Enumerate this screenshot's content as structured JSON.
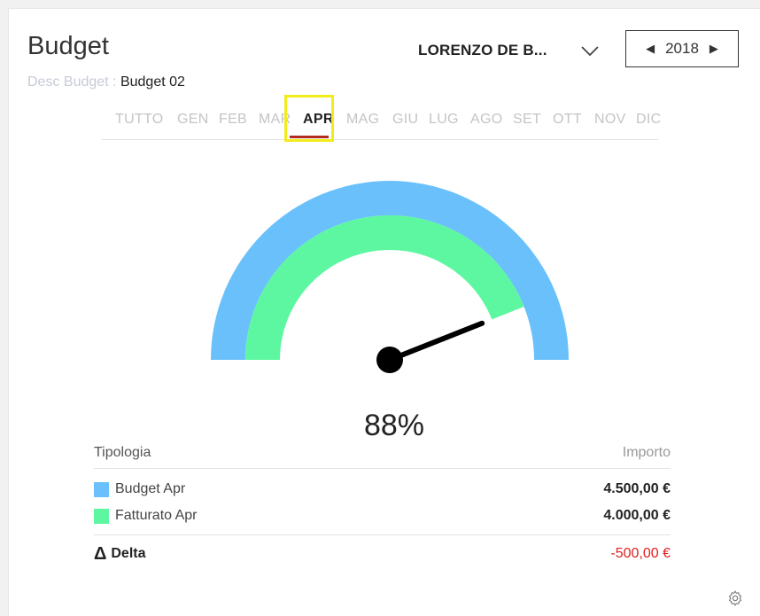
{
  "header": {
    "title": "Budget",
    "desc_label": "Desc Budget :",
    "desc_value": "Budget 02",
    "user": "LORENZO DE B...",
    "year": "2018"
  },
  "months": [
    "TUTTO",
    "GEN",
    "FEB",
    "MAR",
    "APR",
    "MAG",
    "GIU",
    "LUG",
    "AGO",
    "SET",
    "OTT",
    "NOV",
    "DIC"
  ],
  "active_month": "APR",
  "gauge": {
    "percent_label": "88%",
    "fraction": 0.88,
    "outer_color": "#6ac0fb",
    "inner_color": "#5ef7a1"
  },
  "table": {
    "col_type": "Tipologia",
    "col_amount": "Importo",
    "rows": [
      {
        "label": "Budget Apr",
        "value": "4.500,00 €",
        "color": "#6ac0fb"
      },
      {
        "label": "Fatturato Apr",
        "value": "4.000,00 €",
        "color": "#5ef7a1"
      }
    ],
    "delta_symbol": "Δ",
    "delta_label": "Delta",
    "delta_value": "-500,00 €",
    "delta_color": "#e0201f"
  }
}
